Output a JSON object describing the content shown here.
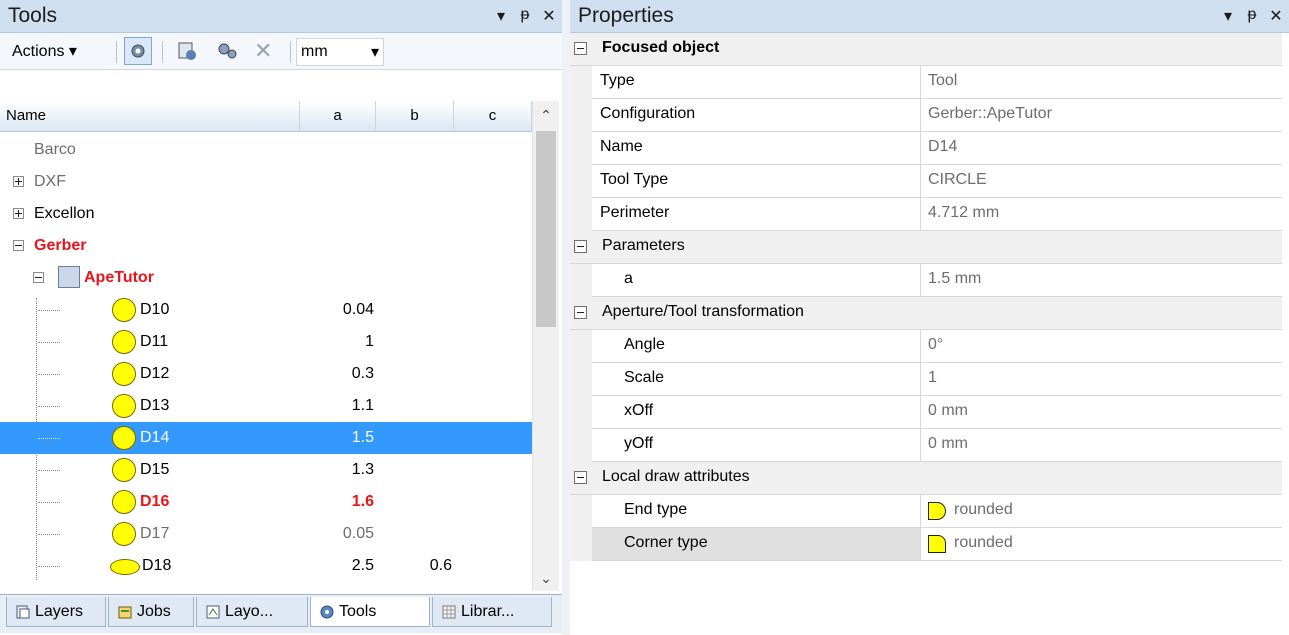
{
  "tools_panel": {
    "title": "Tools",
    "ctrl_dropdown": "▾",
    "ctrl_pin": "ᵽ",
    "ctrl_close": "✕",
    "toolbar": {
      "actions_label": "Actions ▾",
      "unit_value": "mm",
      "unit_arrow": "▾"
    },
    "columns": {
      "name": "Name",
      "a": "a",
      "b": "b",
      "c": "c"
    },
    "tree": [
      {
        "label": "Barco",
        "style": "gray"
      },
      {
        "label": "DXF",
        "style": "gray",
        "expander": "plus"
      },
      {
        "label": "Excellon",
        "style": "normal",
        "expander": "plus"
      },
      {
        "label": "Gerber",
        "style": "red",
        "expander": "minus"
      },
      {
        "label": "ApeTutor",
        "style": "red",
        "icon": "config-icon"
      },
      {
        "label": "D10",
        "a": "0.04",
        "b": "",
        "shape": "circle"
      },
      {
        "label": "D11",
        "a": "1",
        "b": "",
        "shape": "circle"
      },
      {
        "label": "D12",
        "a": "0.3",
        "b": "",
        "shape": "circle"
      },
      {
        "label": "D13",
        "a": "1.1",
        "b": "",
        "shape": "circle"
      },
      {
        "label": "D14",
        "a": "1.5",
        "b": "",
        "shape": "circle",
        "selected": true
      },
      {
        "label": "D15",
        "a": "1.3",
        "b": "",
        "shape": "circle"
      },
      {
        "label": "D16",
        "a": "1.6",
        "b": "",
        "shape": "circle",
        "style": "red"
      },
      {
        "label": "D17",
        "a": "0.05",
        "b": "",
        "shape": "circle",
        "style": "gray"
      },
      {
        "label": "D18",
        "a": "2.5",
        "b": "0.6",
        "shape": "ellipse"
      }
    ],
    "tabs": [
      {
        "label": "Layers"
      },
      {
        "label": "Jobs"
      },
      {
        "label": "Layo..."
      },
      {
        "label": "Tools",
        "active": true
      },
      {
        "label": "Librar..."
      }
    ]
  },
  "properties_panel": {
    "title": "Properties",
    "ctrl_dropdown": "▾",
    "ctrl_pin": "ᵽ",
    "ctrl_close": "✕",
    "categories": {
      "focused": "Focused object",
      "parameters": "Parameters",
      "transformation": "Aperture/Tool transformation",
      "draw": "Local draw attributes"
    },
    "props": {
      "type": {
        "name": "Type",
        "value": "Tool"
      },
      "configuration": {
        "name": "Configuration",
        "value": "Gerber::ApeTutor"
      },
      "name": {
        "name": "Name",
        "value": "D14"
      },
      "tool_type": {
        "name": "Tool Type",
        "value": "CIRCLE"
      },
      "perimeter": {
        "name": "Perimeter",
        "value": "4.712 mm"
      },
      "a": {
        "name": "a",
        "value": "1.5 mm"
      },
      "angle": {
        "name": "Angle",
        "value": "0°"
      },
      "scale": {
        "name": "Scale",
        "value": "1"
      },
      "xoff": {
        "name": "xOff",
        "value": "0 mm"
      },
      "yoff": {
        "name": "yOff",
        "value": "0 mm"
      },
      "end_type": {
        "name": "End type",
        "value": "rounded"
      },
      "corner_type": {
        "name": "Corner type",
        "value": "rounded"
      }
    }
  },
  "colors": {
    "selection": "#3399ff",
    "highlight_red": "#e8151b",
    "aperture_yellow": "#ffff00",
    "title_bg": "#cfdff0"
  }
}
